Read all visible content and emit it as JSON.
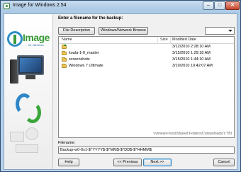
{
  "window": {
    "title": "Image for Windows 2.54",
    "minimize": "–",
    "maximize": "□",
    "close": "✕"
  },
  "logo": {
    "text": "Image",
    "subtext": "for Windows"
  },
  "main": {
    "prompt": "Enter a filename for the backup:",
    "file_description_button": "File Description",
    "network_browse_button": "Windows/Network Browse",
    "path_dropdown_value": ""
  },
  "filelist": {
    "columns": {
      "name": "Name",
      "size": "Size",
      "modified": "Modified Date"
    },
    "rows": [
      {
        "name": "",
        "size": "",
        "modified": "3/12/2010 2:28:10 AM",
        "icon": "folder-up-icon"
      },
      {
        "name": "koala-1-0_master",
        "size": "",
        "modified": "3/15/2010 1:29:18 AM",
        "icon": "folder-icon"
      },
      {
        "name": "screenshots",
        "size": "",
        "modified": "3/15/2010 1:44:10 AM",
        "icon": "folder-icon"
      },
      {
        "name": "Windows 7 Ultimate",
        "size": "",
        "modified": "3/10/2010 10:42:07 AM",
        "icon": "folder-icon"
      }
    ],
    "current_path": "\\\\vmware-host\\Shared Folders\\C\\downloads\\Y.TBI"
  },
  "filename": {
    "label": "Filename:",
    "value": "Backup-w0-0x1-$^YYYY$-$^MM$-$^DD$-$^HHMM$"
  },
  "footer": {
    "help": "Help",
    "previous": "<< Previous",
    "next": "Next >>",
    "cancel": "Cancel"
  },
  "colors": {
    "accent_blue": "#2f86c8",
    "accent_green": "#3aa63a",
    "folder": "#e8c45a"
  }
}
